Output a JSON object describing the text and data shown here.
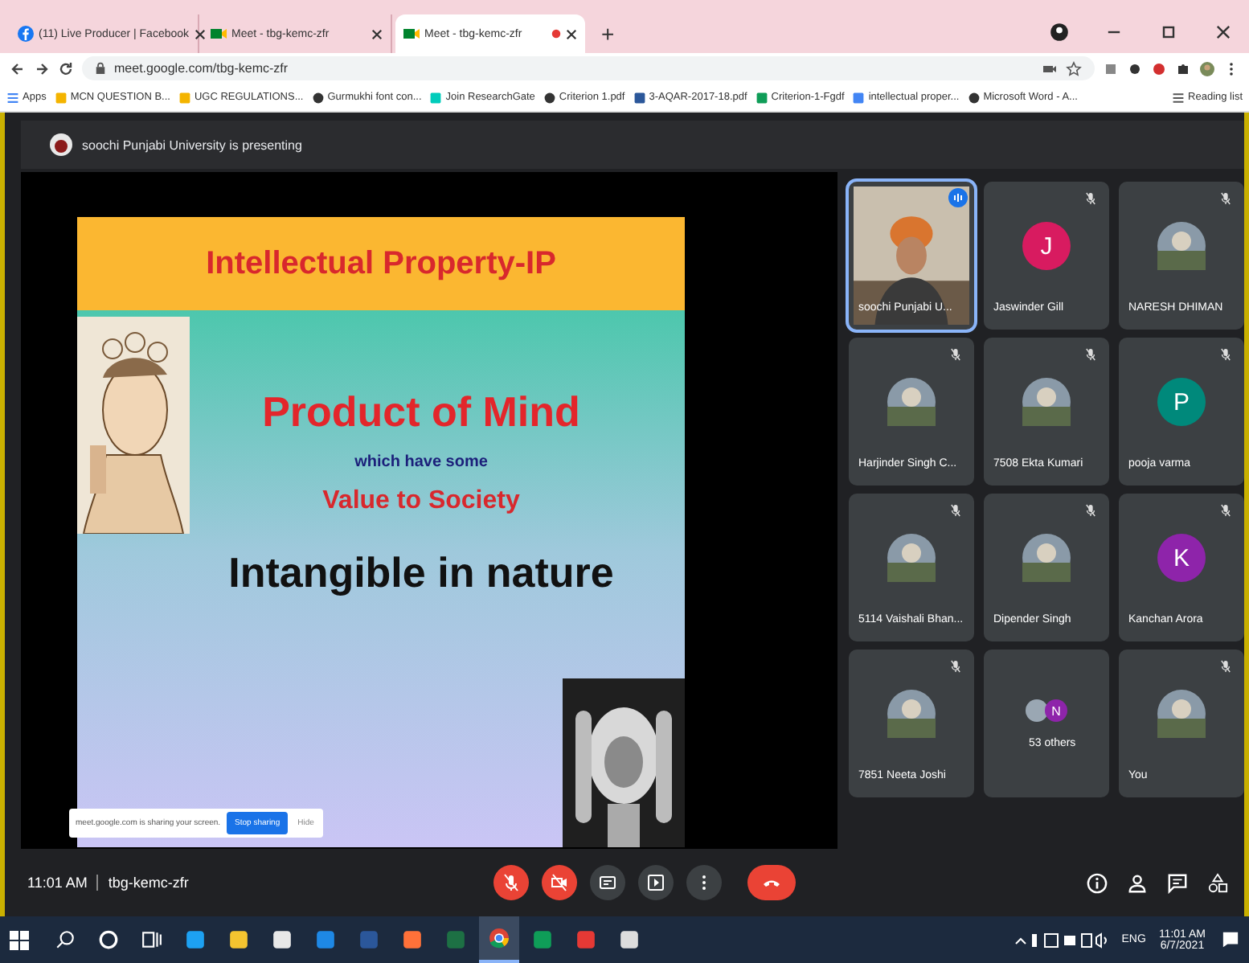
{
  "browser": {
    "tabs": [
      {
        "title": "(11) Live Producer | Facebook",
        "kind": "facebook",
        "selected": false,
        "recording": false
      },
      {
        "title": "Meet - tbg-kemc-zfr",
        "kind": "meet",
        "selected": false,
        "recording": false
      },
      {
        "title": "Meet - tbg-kemc-zfr",
        "kind": "meet",
        "selected": true,
        "recording": true
      }
    ],
    "new_tab": "+",
    "url": "meet.google.com/tbg-kemc-zfr",
    "bookmarks": [
      {
        "label": "Apps",
        "kind": "apps"
      },
      {
        "label": "MCN QUESTION B...",
        "kind": "folder"
      },
      {
        "label": "UGC REGULATIONS...",
        "kind": "doc"
      },
      {
        "label": "Gurmukhi font con...",
        "kind": "globe"
      },
      {
        "label": "Join ResearchGate",
        "kind": "rg"
      },
      {
        "label": "Criterion 1.pdf",
        "kind": "globe"
      },
      {
        "label": "3-AQAR-2017-18.pdf",
        "kind": "word"
      },
      {
        "label": "Criterion-1-Fgdf",
        "kind": "drive"
      },
      {
        "label": "intellectual proper...",
        "kind": "google"
      },
      {
        "label": "Microsoft Word - A...",
        "kind": "globe"
      }
    ],
    "reading_list": "Reading list"
  },
  "meeting": {
    "presenting_banner": "soochi Punjabi University is presenting",
    "slide": {
      "title": "Intellectual Property-IP",
      "heading": "Product of Mind",
      "subtitle": "which have some",
      "tagline": "Value to Society",
      "statement": "Intangible in nature"
    },
    "share_bar": {
      "message": "meet.google.com is sharing your screen.",
      "stop_button": "Stop sharing",
      "hide": "Hide"
    },
    "participants": [
      {
        "name": "soochi Punjabi U...",
        "kind": "video",
        "muted": false,
        "speaking": true
      },
      {
        "name": "Jaswinder Gill",
        "kind": "letter",
        "letter": "J",
        "color": "#d81b60",
        "muted": true,
        "speaking": false
      },
      {
        "name": "NARESH DHIMAN",
        "muted": true,
        "speaking": false
      },
      {
        "name": "Harjinder Singh C...",
        "muted": true,
        "speaking": false
      },
      {
        "name": "7508 Ekta Kumari",
        "muted": true,
        "speaking": false
      },
      {
        "name": "pooja varma",
        "kind": "letter",
        "letter": "P",
        "color": "#00897b",
        "muted": true,
        "speaking": false
      },
      {
        "name": "5114 Vaishali Bhan...",
        "muted": true,
        "speaking": false
      },
      {
        "name": "Dipender Singh",
        "muted": true,
        "speaking": false
      },
      {
        "name": "Kanchan Arora",
        "kind": "letter",
        "letter": "K",
        "color": "#8e24aa",
        "muted": true,
        "speaking": false
      },
      {
        "name": "7851 Neeta Joshi",
        "muted": true,
        "speaking": false
      },
      {
        "name": "53 others",
        "kind": "others",
        "letter": "N",
        "color": "#8e24aa",
        "muted": false,
        "speaking": false
      },
      {
        "name": "You",
        "muted": true,
        "speaking": false
      }
    ],
    "meeting_time": "11:01 AM",
    "meeting_code": "tbg-kemc-zfr",
    "controls": [
      {
        "kind": "mic",
        "on": false
      },
      {
        "kind": "camera",
        "on": false
      },
      {
        "kind": "captions",
        "on": false
      },
      {
        "kind": "present",
        "on": false
      },
      {
        "kind": "more"
      },
      {
        "kind": "end-call"
      }
    ],
    "side_buttons": [
      {
        "kind": "info"
      },
      {
        "kind": "people"
      },
      {
        "kind": "chat"
      },
      {
        "kind": "activities"
      }
    ]
  },
  "taskbar": {
    "apps": [
      {
        "kind": "search",
        "selected": false
      },
      {
        "kind": "cortana",
        "selected": false
      },
      {
        "kind": "taskview",
        "selected": false
      },
      {
        "kind": "edge",
        "selected": false
      },
      {
        "kind": "files",
        "selected": false
      },
      {
        "kind": "store",
        "selected": false
      },
      {
        "kind": "mail",
        "selected": false
      },
      {
        "kind": "word",
        "selected": false
      },
      {
        "kind": "firefox",
        "selected": false
      },
      {
        "kind": "excel",
        "selected": false
      },
      {
        "kind": "chrome",
        "selected": true
      },
      {
        "kind": "bag",
        "selected": false
      },
      {
        "kind": "pdf",
        "selected": false
      },
      {
        "kind": "camera",
        "selected": false
      }
    ],
    "language": "ENG",
    "time": "11:01 AM",
    "date": "6/7/2021"
  }
}
